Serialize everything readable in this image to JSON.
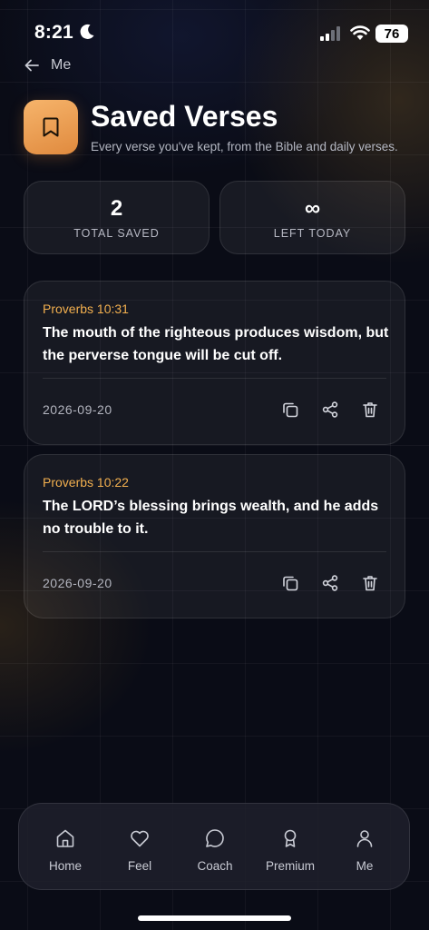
{
  "status": {
    "time": "8:21",
    "battery": "76"
  },
  "back": {
    "label": "Me"
  },
  "header": {
    "title": "Saved Verses",
    "subtitle": "Every verse you've kept, from the Bible and daily verses."
  },
  "stats": [
    {
      "value": "2",
      "label": "TOTAL SAVED"
    },
    {
      "value": "∞",
      "label": "LEFT TODAY"
    }
  ],
  "verses": [
    {
      "reference": "Proverbs 10:31",
      "text": "The mouth of the righteous produces wisdom, but the perverse tongue will be cut off.",
      "date": "2026-09-20"
    },
    {
      "reference": "Proverbs 10:22",
      "text": "The LORD’s blessing brings wealth, and he adds no trouble to it.",
      "date": "2026-09-20"
    }
  ],
  "nav": {
    "items": [
      {
        "label": "Home",
        "icon": "home-icon"
      },
      {
        "label": "Feel",
        "icon": "heart-icon"
      },
      {
        "label": "Coach",
        "icon": "chat-icon"
      },
      {
        "label": "Premium",
        "icon": "award-icon"
      },
      {
        "label": "Me",
        "icon": "user-icon"
      }
    ]
  },
  "colors": {
    "accent": "#f3b04f",
    "icon_gradient_start": "#f6b46b",
    "icon_gradient_end": "#e08a3e",
    "background": "#0a0c16"
  }
}
